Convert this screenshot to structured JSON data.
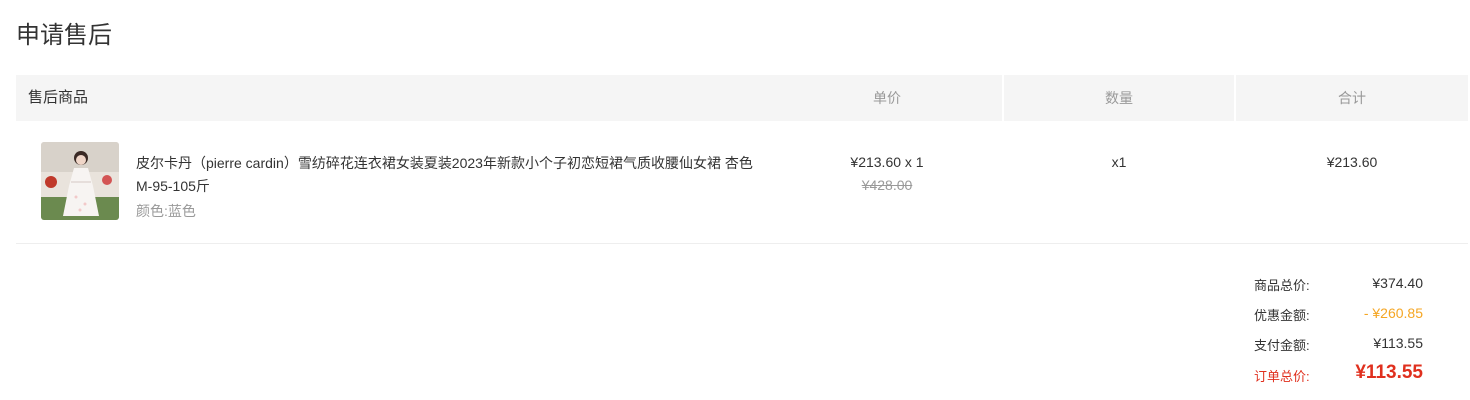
{
  "page": {
    "title": "申请售后"
  },
  "table": {
    "headers": {
      "goods": "售后商品",
      "price": "单价",
      "qty": "数量",
      "total": "合计"
    }
  },
  "item": {
    "name": "皮尔卡丹（pierre cardin）雪纺碎花连衣裙女装夏装2023年新款小个子初恋短裙气质收腰仙女裙 杏色 M-95-105斤",
    "spec": "颜色:蓝色",
    "unit_price": "¥213.60 x 1",
    "original_price": "¥428.00",
    "quantity": "x1",
    "line_total": "¥213.60"
  },
  "summary": {
    "goods_total_label": "商品总价:",
    "goods_total_value": "¥374.40",
    "discount_label": "优惠金额:",
    "discount_value": "- ¥260.85",
    "paid_label": "支付金额:",
    "paid_value": "¥113.55",
    "order_total_label": "订单总价:",
    "order_total_value": "¥113.55"
  },
  "colors": {
    "accent_red": "#e0301e",
    "discount_orange": "#f5a623",
    "header_bg": "#f5f5f5"
  }
}
